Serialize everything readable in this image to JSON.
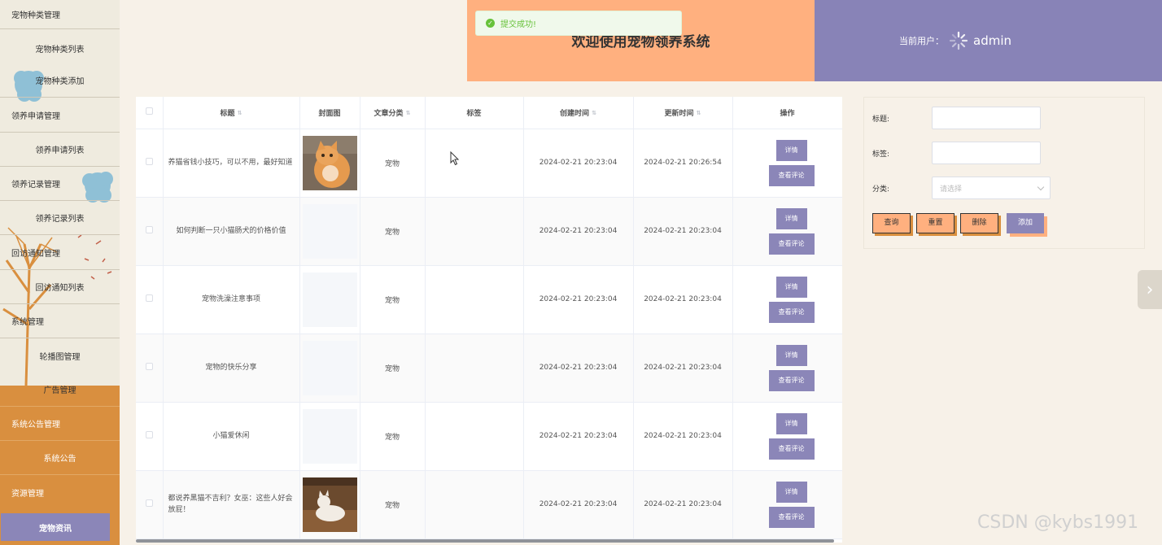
{
  "sidebar": {
    "items": [
      {
        "label": "宠物种类管理",
        "type": "group"
      },
      {
        "label": "宠物种类列表",
        "type": "sub"
      },
      {
        "label": "宠物种类添加",
        "type": "sub"
      },
      {
        "label": "领养申请管理",
        "type": "group"
      },
      {
        "label": "领养申请列表",
        "type": "sub"
      },
      {
        "label": "领养记录管理",
        "type": "group"
      },
      {
        "label": "领养记录列表",
        "type": "sub"
      },
      {
        "label": "回访通知管理",
        "type": "group"
      },
      {
        "label": "回访通知列表",
        "type": "sub"
      },
      {
        "label": "系统管理",
        "type": "group"
      },
      {
        "label": "轮播图管理",
        "type": "sub"
      },
      {
        "label": "广告管理",
        "type": "sub"
      },
      {
        "label": "系统公告管理",
        "type": "group"
      },
      {
        "label": "系统公告",
        "type": "sub"
      },
      {
        "label": "资源管理",
        "type": "group"
      },
      {
        "label": "宠物资讯",
        "type": "active"
      }
    ]
  },
  "header": {
    "title": "欢迎使用宠物领养系统",
    "current_user_label": "当前用户：",
    "username": "admin"
  },
  "toast": {
    "message": "提交成功!"
  },
  "table": {
    "columns": [
      "标题",
      "封面图",
      "文章分类",
      "标签",
      "创建时间",
      "更新时间",
      "操作"
    ],
    "rows": [
      {
        "title": "养猫省钱小技巧，可以不用，最好知道",
        "cover": "cat-orange",
        "category": "宠物",
        "tag": "",
        "created": "2024-02-21 20:23:04",
        "updated": "2024-02-21 20:26:54"
      },
      {
        "title": "如何判断一只小猫肠犬的价格价值",
        "cover": "",
        "category": "宠物",
        "tag": "",
        "created": "2024-02-21 20:23:04",
        "updated": "2024-02-21 20:23:04"
      },
      {
        "title": "宠物洗澡注意事项",
        "cover": "",
        "category": "宠物",
        "tag": "",
        "created": "2024-02-21 20:23:04",
        "updated": "2024-02-21 20:23:04"
      },
      {
        "title": "宠物的快乐分享",
        "cover": "",
        "category": "宠物",
        "tag": "",
        "created": "2024-02-21 20:23:04",
        "updated": "2024-02-21 20:23:04"
      },
      {
        "title": "小猫爱休闲",
        "cover": "",
        "category": "宠物",
        "tag": "",
        "created": "2024-02-21 20:23:04",
        "updated": "2024-02-21 20:23:04"
      },
      {
        "title": "都说养黑猫不吉利？女巫：这些人好会放屁！",
        "cover": "cat-white",
        "category": "宠物",
        "tag": "",
        "created": "2024-02-21 20:23:04",
        "updated": "2024-02-21 20:23:04"
      }
    ],
    "detail_label": "详情",
    "comments_label": "查看评论"
  },
  "search": {
    "title_label": "标题:",
    "tag_label": "标签:",
    "category_label": "分类:",
    "category_placeholder": "请选择",
    "query_label": "查询",
    "reset_label": "重置",
    "delete_label": "删除",
    "add_label": "添加"
  },
  "watermark": "CSDN @kybs1991",
  "colors": {
    "accent_purple": "#8b86b8",
    "accent_orange": "#ffb07f",
    "sidebar_orange": "#d98f3f",
    "success": "#67c23a"
  }
}
